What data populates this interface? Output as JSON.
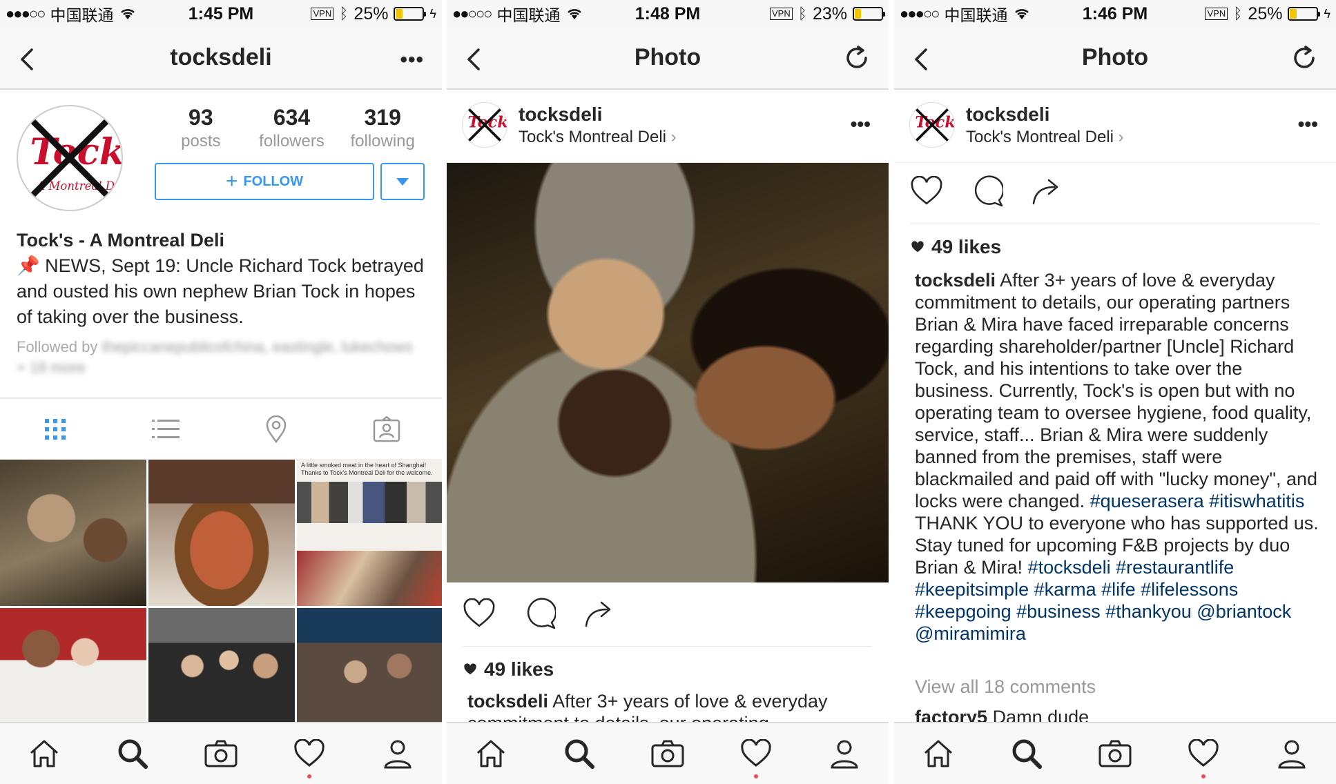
{
  "colors": {
    "accent": "#3897f0",
    "hashtag": "#003569",
    "notify": "#ed4956",
    "battery": "#f5c400"
  },
  "status_bars": [
    {
      "signal": "●●●○○",
      "carrier": "中国联通",
      "time": "1:45 PM",
      "vpn": "VPN",
      "battery": "25%",
      "battery_level": 0.25
    },
    {
      "signal": "●●○○○",
      "carrier": "中国联通",
      "time": "1:48 PM",
      "vpn": "VPN",
      "battery": "23%",
      "battery_level": 0.23
    },
    {
      "signal": "●●●○○",
      "carrier": "中国联通",
      "time": "1:46 PM",
      "vpn": "VPN",
      "battery": "25%",
      "battery_level": 0.25
    }
  ],
  "profile": {
    "nav_title": "tocksdeli",
    "stats": [
      {
        "num": "93",
        "label": "posts"
      },
      {
        "num": "634",
        "label": "followers"
      },
      {
        "num": "319",
        "label": "following"
      }
    ],
    "follow_label": "FOLLOW",
    "name": "Tock's - A Montreal Deli",
    "bio_pin": "📌",
    "bio": "NEWS, Sept 19: Uncle Richard Tock betrayed and ousted his own nephew Brian Tock in hopes of taking over the business.",
    "followed_by": "Followed by",
    "followed_by_blurred": "thepiccanepublicofchina, eastingle, lukechows + 18 more",
    "grid_caption": "A little smoked meat in the heart of Shanghai! Thanks to Tock's Montreal Deli for the welcome."
  },
  "post": {
    "nav_title": "Photo",
    "username": "tocksdeli",
    "location": "Tock's Montreal Deli",
    "likes": "49 likes",
    "caption_user": "tocksdeli",
    "caption_short": "After 3+ years of love & everyday",
    "caption_short2": "commitment to details, our operating",
    "caption_text": "After 3+ years of love & everyday commitment to details, our operating partners Brian & Mira have faced irreparable concerns regarding shareholder/partner [Uncle] Richard Tock, and his intentions to take over the business. Currently, Tock's is open but with no operating team to oversee hygiene, food quality, service, staff... Brian & Mira were suddenly banned from the premises, staff were blackmailed and paid off with \"lucky money\", and locks were changed.",
    "tags1": "#queserasera #itiswhatitis",
    "caption_text2": "THANK YOU to everyone who has supported us. Stay tuned for upcoming F&B projects by duo Brian & Mira!",
    "tags2": "#tocksdeli #restaurantlife #keepitsimple #karma #life #lifelessons #keepgoing #business #thankyou @briantock @miramimira",
    "view_comments": "View all 18 comments",
    "comment_user": "factory5",
    "comment_text": "Damn dude"
  },
  "logo": {
    "line1": "Tock's",
    "line2": "A Montreal Deli"
  }
}
